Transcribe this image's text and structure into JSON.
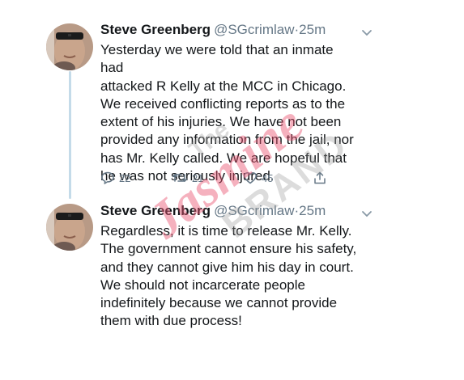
{
  "tweets": [
    {
      "author_name": "Steve Greenberg",
      "handle": "@SGcrimlaw",
      "separator": "·",
      "time": "25m",
      "lines": [
        "Yesterday we were told that an inmate had",
        "attacked R Kelly at the MCC in Chicago.",
        "We received conflicting reports as to the",
        "extent of his injuries. We have not been",
        "provided any information from the jail, nor",
        "has Mr. Kelly called. We are hopeful that",
        "he was not seriously injured."
      ],
      "replies": "22",
      "retweets": "21",
      "likes": "45",
      "icons": [
        "reply-icon",
        "retweet-icon",
        "like-icon",
        "share-icon",
        "chevron-down-icon"
      ]
    },
    {
      "author_name": "Steve Greenberg",
      "handle": "@SGcrimlaw",
      "separator": "·",
      "time": "25m",
      "lines": [
        "Regardless, it is time to release Mr. Kelly.",
        "The government cannot ensure his safety,",
        "and they cannot give him his day in court.",
        "We should not incarcerate people",
        "indefinitely because we cannot provide",
        "them with due process!"
      ],
      "icons": [
        "chevron-down-icon"
      ]
    }
  ],
  "watermark": {
    "line1": "The",
    "line2": "Jasmine",
    "line3": "BRAND"
  },
  "colors": {
    "text": "#14171a",
    "secondary": "#657786",
    "thread_line": "#c4dbe9",
    "watermark_pink": "#e8536e",
    "watermark_gray": "#9a9a9a"
  }
}
